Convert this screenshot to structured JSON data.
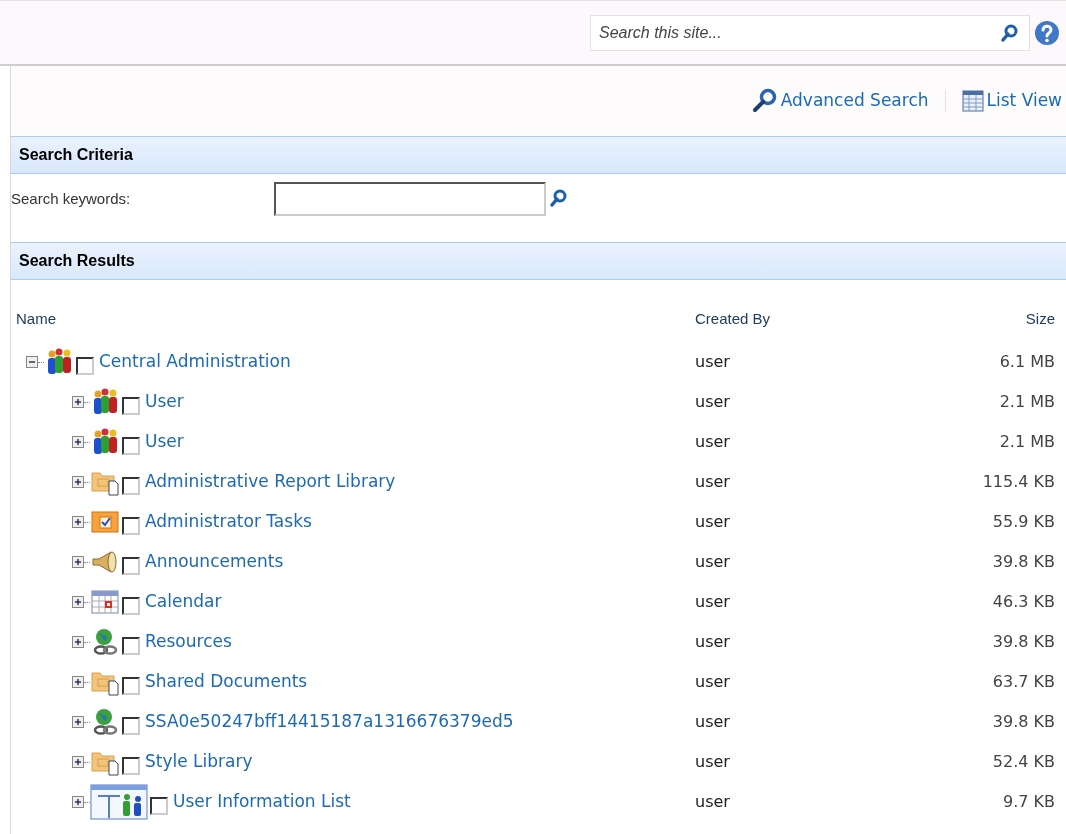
{
  "top_search": {
    "placeholder": "Search this site..."
  },
  "actions": [
    {
      "kind": "search",
      "label": "Advanced Search"
    },
    {
      "kind": "list",
      "label": "List View"
    }
  ],
  "criteria": {
    "title": "Search Criteria",
    "keywords_label": "Search keywords:"
  },
  "results": {
    "title": "Search Results",
    "columns": [
      "Name",
      "Created By",
      "Size"
    ],
    "tree": [
      {
        "kind": "site",
        "name": "Central Administration",
        "created_by": "user",
        "size": "6.1 MB",
        "expanded": true,
        "checked": false,
        "children": [
          {
            "kind": "site",
            "name": "User",
            "created_by": "user",
            "size": "2.1 MB",
            "expanded": false,
            "checked": false
          },
          {
            "kind": "site",
            "name": "User",
            "created_by": "user",
            "size": "2.1 MB",
            "expanded": false,
            "checked": false
          },
          {
            "kind": "library",
            "name": "Administrative Report Library",
            "created_by": "user",
            "size": "115.4 KB",
            "expanded": false,
            "checked": false
          },
          {
            "kind": "tasks",
            "name": "Administrator Tasks",
            "created_by": "user",
            "size": "55.9 KB",
            "expanded": false,
            "checked": false
          },
          {
            "kind": "announcements",
            "name": "Announcements",
            "created_by": "user",
            "size": "39.8 KB",
            "expanded": false,
            "checked": false
          },
          {
            "kind": "calendar",
            "name": "Calendar",
            "created_by": "user",
            "size": "46.3 KB",
            "expanded": false,
            "checked": false
          },
          {
            "kind": "links",
            "name": "Resources",
            "created_by": "user",
            "size": "39.8 KB",
            "expanded": false,
            "checked": false
          },
          {
            "kind": "library",
            "name": "Shared Documents",
            "created_by": "user",
            "size": "63.7 KB",
            "expanded": false,
            "checked": false
          },
          {
            "kind": "links",
            "name": "SSA0e50247bff14415187a1316676379ed5",
            "created_by": "user",
            "size": "39.8 KB",
            "expanded": false,
            "checked": false
          },
          {
            "kind": "library",
            "name": "Style Library",
            "created_by": "user",
            "size": "52.4 KB",
            "expanded": false,
            "checked": false
          },
          {
            "kind": "list",
            "name": "User Information List",
            "created_by": "user",
            "size": "9.7 KB",
            "expanded": false,
            "checked": false
          }
        ]
      }
    ]
  }
}
